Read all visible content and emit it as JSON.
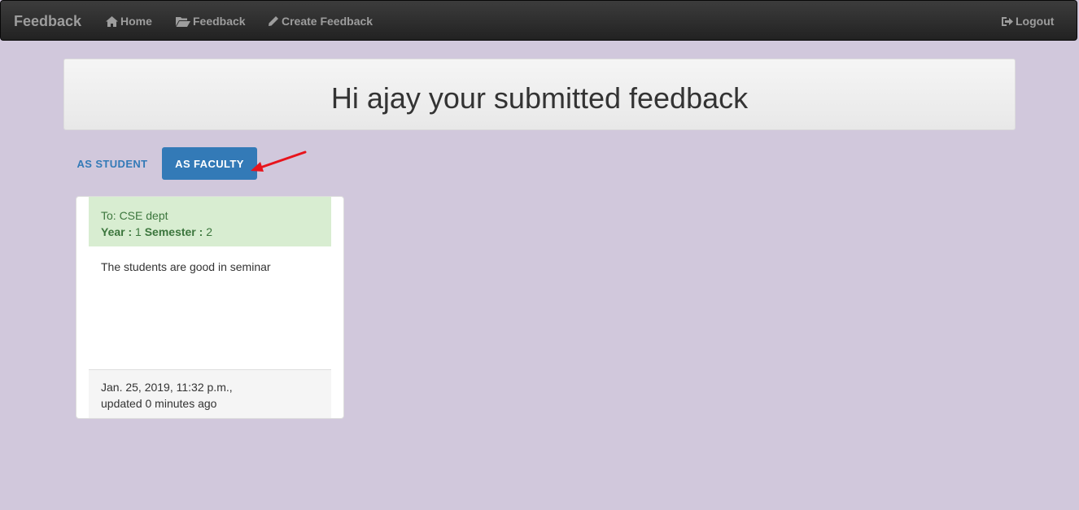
{
  "navbar": {
    "brand": "Feedback",
    "items": [
      {
        "label": "Home",
        "icon": "home-icon"
      },
      {
        "label": "Feedback",
        "icon": "folder-open-icon"
      },
      {
        "label": "Create Feedback",
        "icon": "pencil-icon"
      }
    ],
    "logout": {
      "label": "Logout",
      "icon": "logout-icon"
    }
  },
  "header": {
    "title": "Hi ajay your submitted feedback"
  },
  "tabs": {
    "student": "AS STUDENT",
    "faculty": "AS FACULTY"
  },
  "card": {
    "to_label": "To: CSE dept",
    "year_label": "Year :",
    "year_value": " 1 ",
    "semester_label": "Semester :",
    "semester_value": " 2",
    "message": "The students are good in seminar",
    "date": "Jan. 25, 2019, 11:32 p.m.,",
    "updated": "updated 0 minutes ago"
  },
  "colors": {
    "accent": "#337ab7",
    "background": "#d1c8dc",
    "success": "#3c763d",
    "annotation_arrow": "#e8141c"
  }
}
